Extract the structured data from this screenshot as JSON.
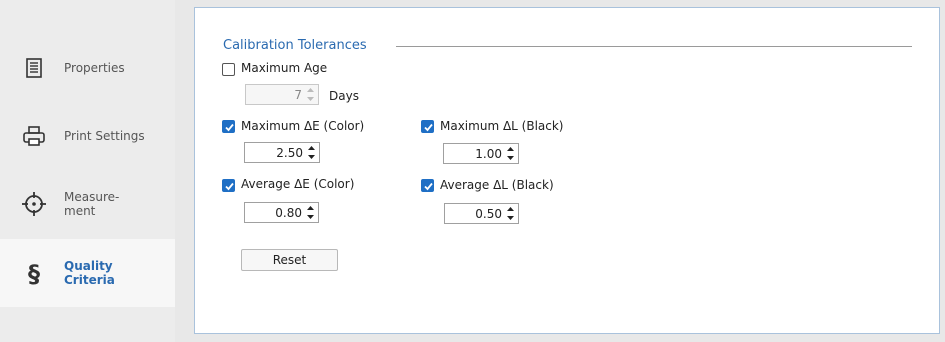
{
  "sidebar": {
    "items": [
      {
        "label": "Properties",
        "icon": "document-list-icon",
        "active": false
      },
      {
        "label": "Print Settings",
        "icon": "printer-icon",
        "active": false
      },
      {
        "label": "Measure-\nment",
        "icon": "crosshair-icon",
        "active": false
      },
      {
        "label": "Quality\nCriteria",
        "icon": "section-sign-icon",
        "active": true
      }
    ],
    "active_color": "#2a6ab0"
  },
  "group": {
    "title": "Calibration Tolerances",
    "max_age": {
      "label": "Maximum Age",
      "checked": false,
      "value": "7",
      "unit": "Days",
      "enabled": false
    },
    "max_de": {
      "label": "Maximum ΔE (Color)",
      "checked": true,
      "value": "2.50"
    },
    "avg_de": {
      "label": "Average ΔE (Color)",
      "checked": true,
      "value": "0.80"
    },
    "max_dl": {
      "label": "Maximum ΔL (Black)",
      "checked": true,
      "value": "1.00"
    },
    "avg_dl": {
      "label": "Average ΔL (Black)",
      "checked": true,
      "value": "0.50"
    }
  },
  "reset_label": "Reset",
  "colors": {
    "accent": "#2a6ab0",
    "checkbox": "#1f6fc5",
    "panel_border": "#a9c2dc"
  }
}
